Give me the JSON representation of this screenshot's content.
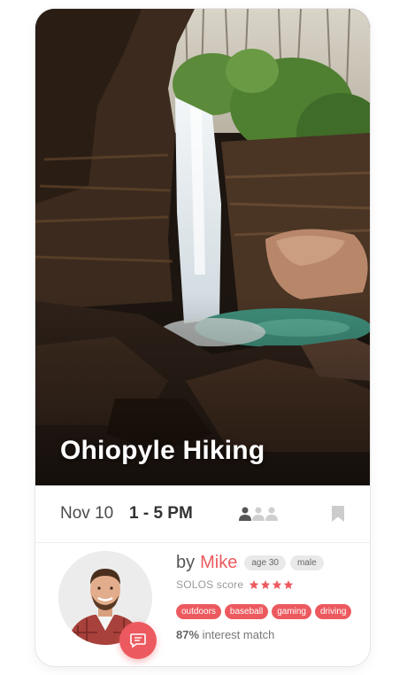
{
  "event": {
    "title": "Ohiopyle Hiking",
    "date": "Nov 10",
    "time": "1 - 5 PM",
    "attendees": {
      "joined": 1,
      "capacity": 3
    },
    "bookmarked": false
  },
  "host": {
    "by_label": "by",
    "name": "Mike",
    "age_chip": "age 30",
    "gender_chip": "male",
    "score_label": "SOLOS score",
    "score_stars": 4,
    "tags": [
      "outdoors",
      "baseball",
      "gaming",
      "driving"
    ],
    "match_percent": "87%",
    "match_label": "interest match"
  },
  "icons": {
    "attendee": "person-icon",
    "bookmark": "bookmark-icon",
    "chat": "chat-icon",
    "star": "star-icon"
  },
  "colors": {
    "accent": "#ec5a5f",
    "chip_bg": "#e9e9e9",
    "inactive_person": "#cfcfcf",
    "bookmark": "#cccccc"
  }
}
